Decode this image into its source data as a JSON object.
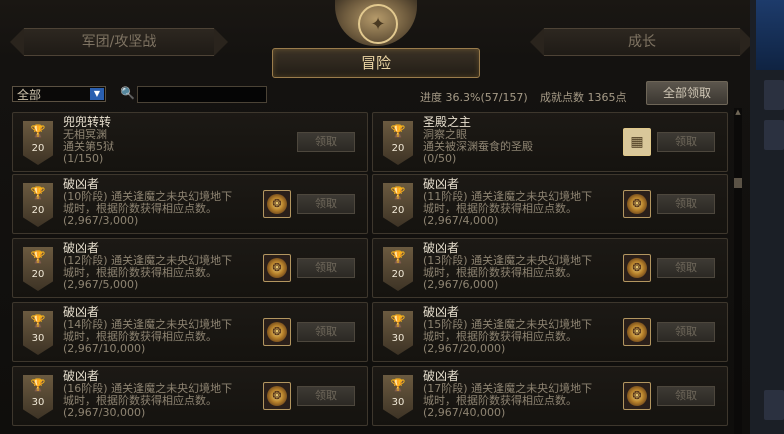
{
  "tabs": {
    "left": "军团/攻坚战",
    "right": "成长",
    "active": "冒险"
  },
  "filter": {
    "selected": "全部",
    "search_placeholder": ""
  },
  "progress": {
    "label": "进度",
    "value": "36.3%(57/157)"
  },
  "points": {
    "label": "成就点数",
    "value": "1365点"
  },
  "claim_all_label": "全部领取",
  "claim_label": "领取",
  "cards": [
    {
      "level": "20",
      "title": "兜兜转转",
      "line1": "无相冥渊",
      "line2": "通关第5狱",
      "count": "(1/150)",
      "icon": "none"
    },
    {
      "level": "20",
      "title": "圣殿之主",
      "line1": "洞察之眼",
      "line2": "通关被深渊蚕食的圣殿",
      "count": "(0/50)",
      "icon": "map-icon"
    },
    {
      "level": "20",
      "title": "破凶者",
      "line1": "(10阶段) 通关逢魔之未央幻境地下",
      "line2": "城时，根据阶数获得相应点数。",
      "count": "(2,967/3,000)",
      "icon": "emblem-icon"
    },
    {
      "level": "20",
      "title": "破凶者",
      "line1": "(11阶段) 通关逢魔之未央幻境地下",
      "line2": "城时，根据阶数获得相应点数。",
      "count": "(2,967/4,000)",
      "icon": "emblem-icon"
    },
    {
      "level": "20",
      "title": "破凶者",
      "line1": "(12阶段) 通关逢魔之未央幻境地下",
      "line2": "城时，根据阶数获得相应点数。",
      "count": "(2,967/5,000)",
      "icon": "emblem-icon"
    },
    {
      "level": "20",
      "title": "破凶者",
      "line1": "(13阶段) 通关逢魔之未央幻境地下",
      "line2": "城时，根据阶数获得相应点数。",
      "count": "(2,967/6,000)",
      "icon": "emblem-icon"
    },
    {
      "level": "30",
      "title": "破凶者",
      "line1": "(14阶段) 通关逢魔之未央幻境地下",
      "line2": "城时，根据阶数获得相应点数。",
      "count": "(2,967/10,000)",
      "icon": "emblem-icon"
    },
    {
      "level": "30",
      "title": "破凶者",
      "line1": "(15阶段) 通关逢魔之未央幻境地下",
      "line2": "城时，根据阶数获得相应点数。",
      "count": "(2,967/20,000)",
      "icon": "emblem-icon"
    },
    {
      "level": "30",
      "title": "破凶者",
      "line1": "(16阶段) 通关逢魔之未央幻境地下",
      "line2": "城时，根据阶数获得相应点数。",
      "count": "(2,967/30,000)",
      "icon": "emblem-icon"
    },
    {
      "level": "30",
      "title": "破凶者",
      "line1": "(17阶段) 通关逢魔之未央幻境地下",
      "line2": "城时，根据阶数获得相应点数。",
      "count": "(2,967/40,000)",
      "icon": "emblem-icon"
    }
  ]
}
